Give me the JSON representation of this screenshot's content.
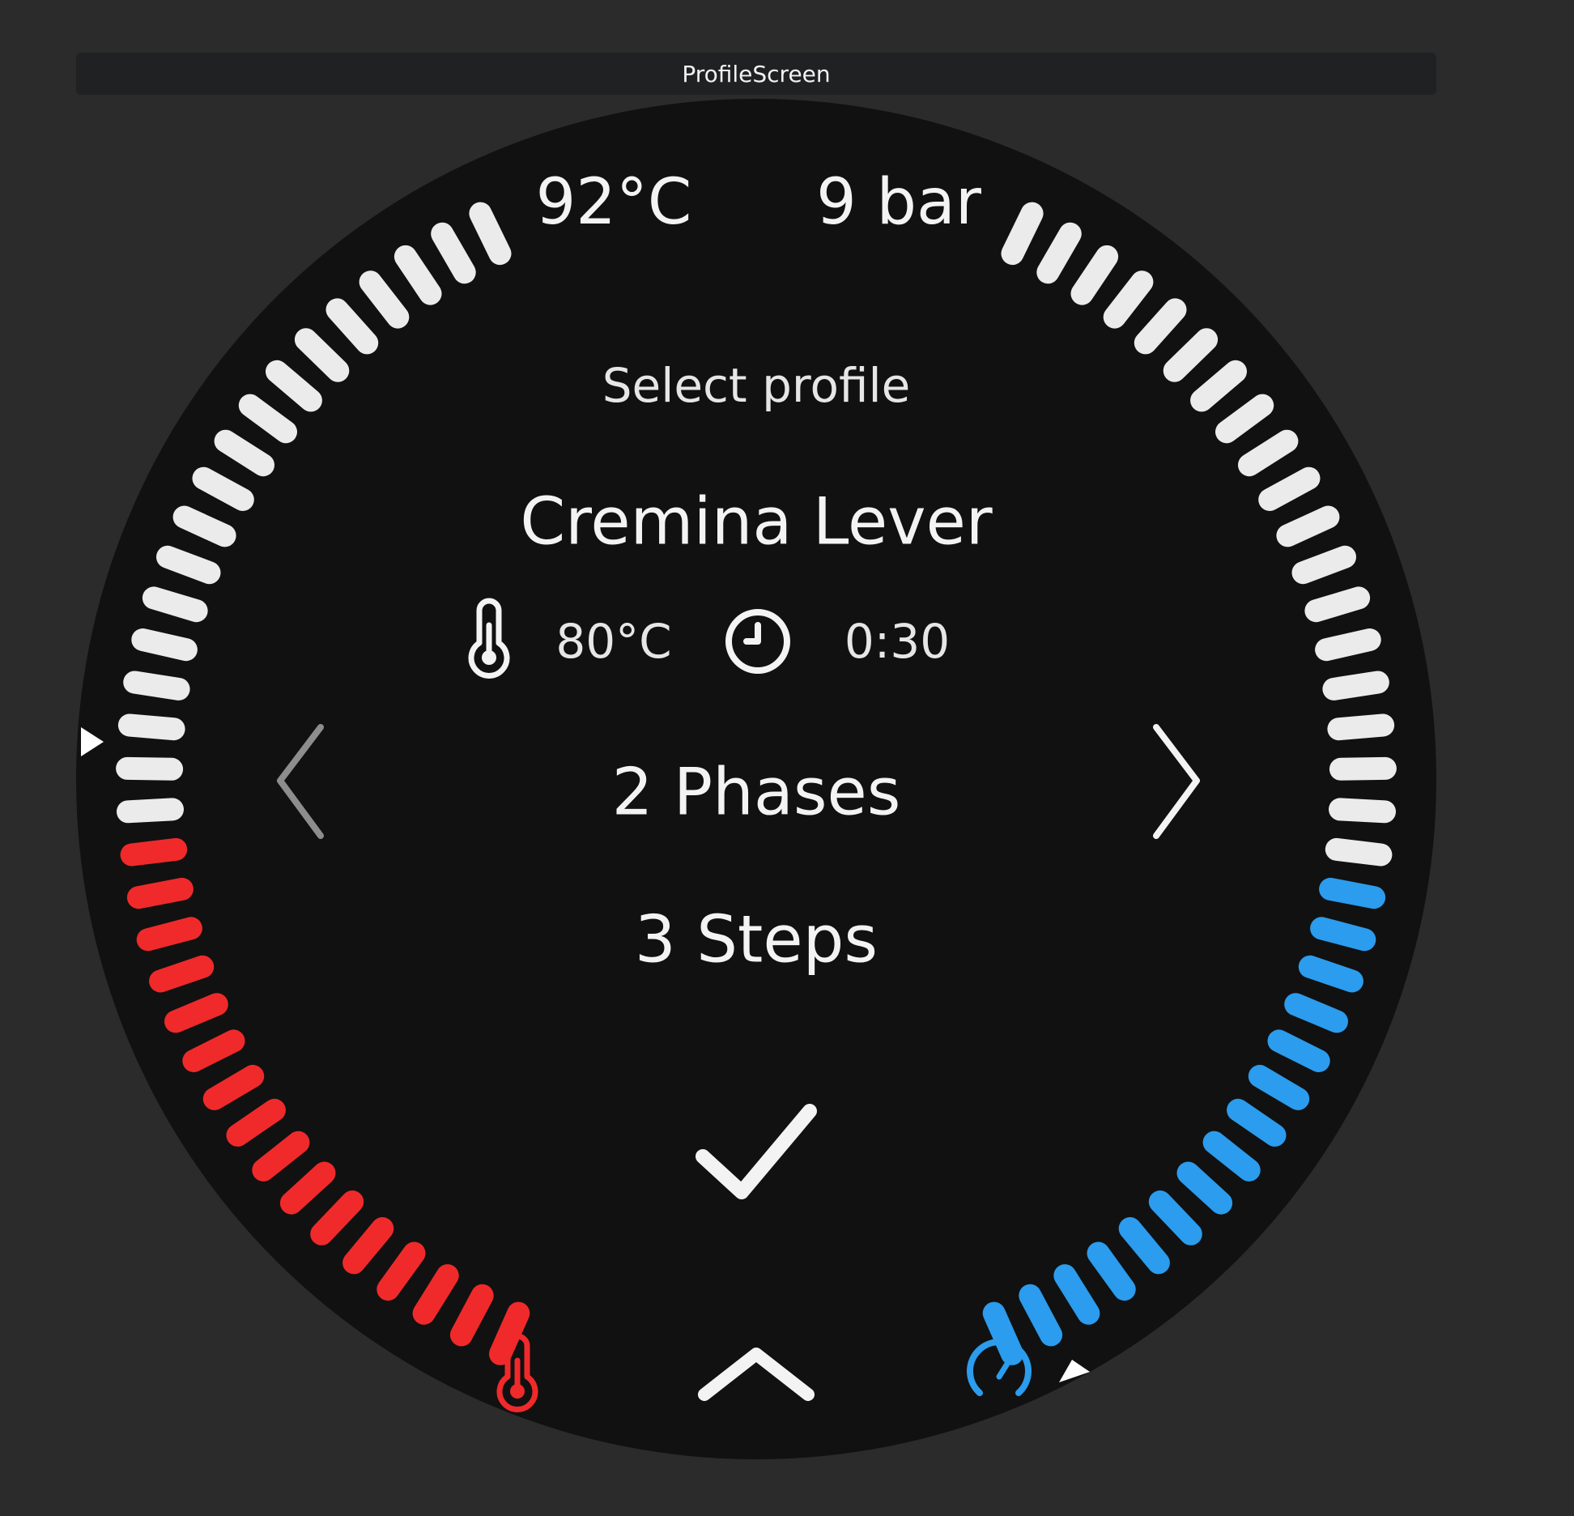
{
  "window": {
    "title": "ProfileScreen"
  },
  "top": {
    "temperature": "92°C",
    "pressure": "9 bar"
  },
  "profile": {
    "heading": "Select profile",
    "name": "Cremina Lever",
    "temperature": "80°C",
    "duration": "0:30",
    "phases": "2 Phases",
    "steps": "3 Steps"
  },
  "gauges": {
    "temperature": {
      "level": 0.46,
      "active_color": "#f02a2a",
      "inactive_color": "#ebebeb"
    },
    "pressure": {
      "level": 0.45,
      "active_color": "#2b9cee",
      "inactive_color": "#ebebeb"
    }
  },
  "icons": {
    "thermometer": "thermometer-icon",
    "clock": "clock-icon",
    "prev": "chevron-left-icon",
    "next": "chevron-right-icon",
    "confirm": "checkmark-icon",
    "up": "chevron-up-icon",
    "temp_gauge": "thermometer-icon",
    "pressure_gauge": "gauge-icon"
  },
  "colors": {
    "background": "#2b2b2b",
    "dial": "#111111",
    "bar": "#202122"
  }
}
